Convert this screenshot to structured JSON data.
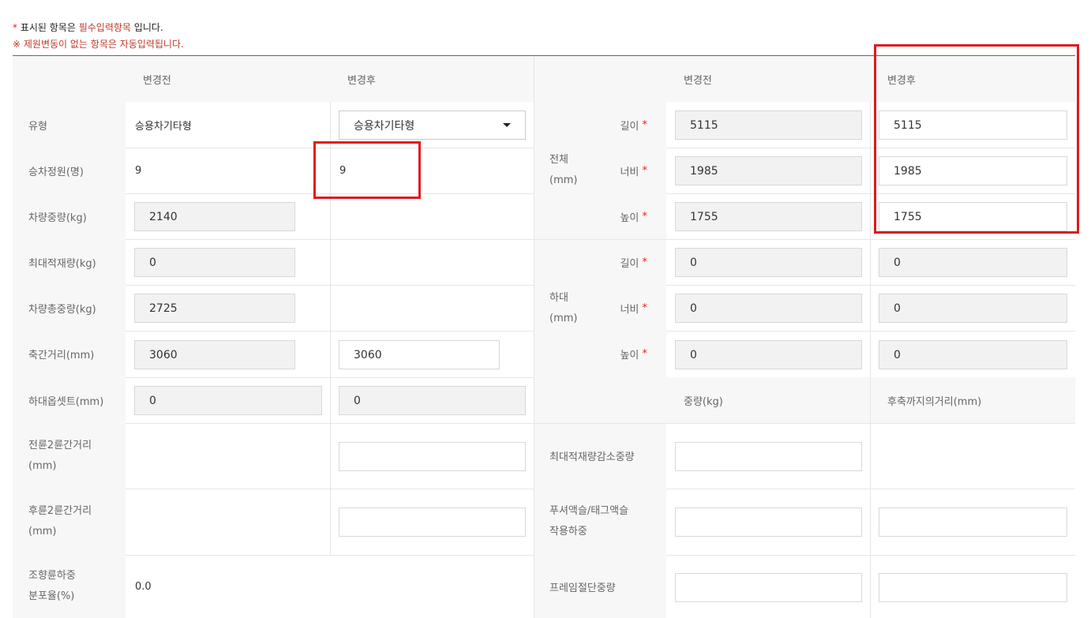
{
  "notices": {
    "required": {
      "star": "*",
      "prefix": "표시된 항목은",
      "highlight": "필수입력항목",
      "suffix": "입니다."
    },
    "auto": "※ 제원변동이 없는 항목은 자동입력됩니다."
  },
  "headers": {
    "before": "변경전",
    "after": "변경후",
    "before2": "변경전",
    "after2": "변경후"
  },
  "left": {
    "type": {
      "label": "유형",
      "before": "승용차기타형",
      "after": "승용차기타형"
    },
    "capacity": {
      "label": "승차정원(명)",
      "before": "9",
      "after": "9"
    },
    "curb_weight": {
      "label": "차량중량(kg)",
      "before": "2140"
    },
    "max_load": {
      "label": "최대적재량(kg)",
      "before": "0"
    },
    "gross_weight": {
      "label": "차량총중량(kg)",
      "before": "2725"
    },
    "wheelbase": {
      "label": "축간거리(mm)",
      "before": "3060",
      "after": "3060"
    },
    "overhang": {
      "label": "하대옵셋트(mm)",
      "before": "0",
      "after": "0"
    },
    "front_track": {
      "label1": "전륜2륜간거리",
      "label2": "(mm)",
      "after": ""
    },
    "rear_track": {
      "label1": "후륜2륜간거리",
      "label2": "(mm)",
      "after": ""
    },
    "steer_dist": {
      "label1": "조향륜하중",
      "label2": "분포율(%)",
      "value": "0.0"
    }
  },
  "right": {
    "overall": {
      "group1": "전체",
      "group2": "(mm)",
      "length": {
        "label": "길이",
        "before": "5115",
        "after": "5115"
      },
      "width": {
        "label": "너비",
        "before": "1985",
        "after": "1985"
      },
      "height": {
        "label": "높이",
        "before": "1755",
        "after": "1755"
      }
    },
    "cargo": {
      "group1": "하대",
      "group2": "(mm)",
      "length": {
        "label": "길이",
        "before": "0",
        "after": "0"
      },
      "width": {
        "label": "너비",
        "before": "0",
        "after": "0"
      },
      "height": {
        "label": "높이",
        "before": "0",
        "after": "0"
      }
    },
    "weight_header": "중량(kg)",
    "rear_axle_header": "후축까지의거리(mm)",
    "max_load_reduce": {
      "label": "최대적재량감소중량",
      "weight": ""
    },
    "pusher_axle": {
      "label1": "푸셔액슬/태그액슬",
      "label2": "작용하중",
      "weight": "",
      "distance": ""
    },
    "frame_cut": {
      "label": "프레임절단중량",
      "weight": "",
      "distance": ""
    }
  },
  "required_mark": "*",
  "colors": {
    "required": "#e2241b",
    "highlight_box": "#e0191f"
  }
}
